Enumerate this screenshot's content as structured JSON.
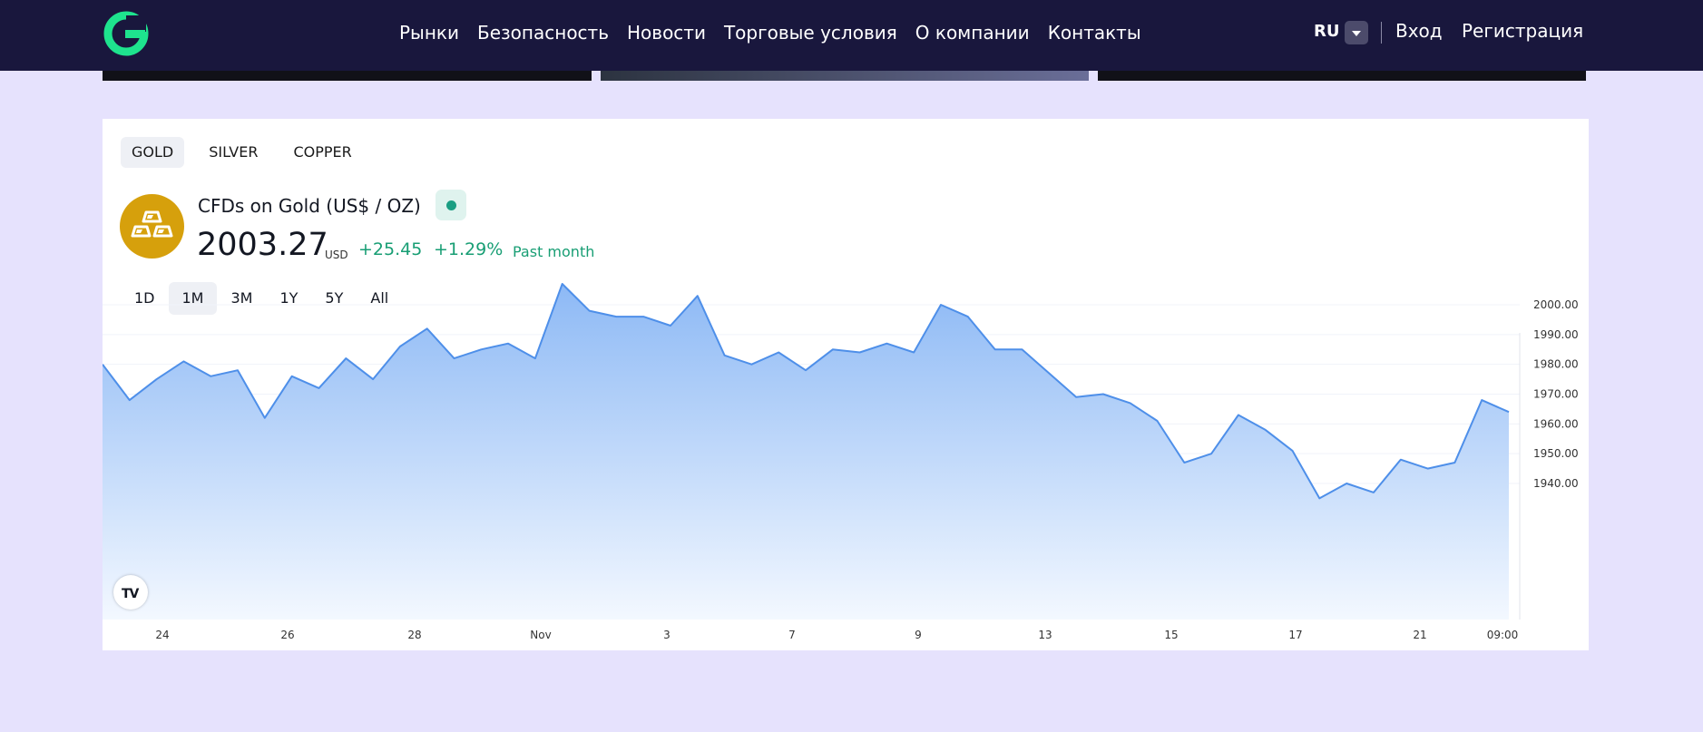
{
  "nav": {
    "links": [
      "Рынки",
      "Безопасность",
      "Новости",
      "Торговые условия",
      "О компании",
      "Контакты"
    ],
    "lang": "RU",
    "login": "Вход",
    "register": "Регистрация"
  },
  "widget": {
    "tabs": [
      "GOLD",
      "SILVER",
      "COPPER"
    ],
    "active_tab": "GOLD",
    "title": "CFDs on Gold (US$ / OZ)",
    "price": "2003.27",
    "price_unit": "USD",
    "change": "+25.45",
    "change_pct": "+1.29%",
    "period": "Past month",
    "ranges": [
      "1D",
      "1M",
      "3M",
      "1Y",
      "5Y",
      "All"
    ],
    "active_range": "1M",
    "tv_logo": "TV"
  },
  "colors": {
    "nav_bg": "#19173d",
    "page_bg": "#e6e2fd",
    "accent_green": "#189e74",
    "line": "#4e8fe9",
    "coin": "#d6a00c"
  },
  "chart_data": {
    "type": "area",
    "x_tick_labels": [
      "24",
      "26",
      "28",
      "Nov",
      "3",
      "7",
      "9",
      "13",
      "15",
      "17",
      "21",
      "09:00"
    ],
    "y_tick_labels": [
      "2000.00",
      "1990.00",
      "1980.00",
      "1970.00",
      "1960.00",
      "1950.00",
      "1940.00"
    ],
    "ylim": [
      1930,
      2010
    ],
    "x": [
      "Oct 23",
      "Oct 24",
      "Oct 24",
      "Oct 25",
      "Oct 25",
      "Oct 26",
      "Oct 26",
      "Oct 27",
      "Oct 27",
      "Oct 28",
      "Oct 28",
      "Oct 29",
      "Oct 29",
      "Oct 30",
      "Oct 31",
      "Nov 1",
      "Nov 1",
      "Nov 2",
      "Nov 2",
      "Nov 3",
      "Nov 3",
      "Nov 4",
      "Nov 4",
      "Nov 5",
      "Nov 6",
      "Nov 7",
      "Nov 7",
      "Nov 8",
      "Nov 8",
      "Nov 9",
      "Nov 9",
      "Nov 10",
      "Nov 10",
      "Nov 11",
      "Nov 12",
      "Nov 13",
      "Nov 13",
      "Nov 14",
      "Nov 14",
      "Nov 15",
      "Nov 15",
      "Nov 16",
      "Nov 16",
      "Nov 17",
      "Nov 17",
      "Nov 18",
      "Nov 19",
      "Nov 20",
      "Nov 20",
      "Nov 21",
      "Nov 21",
      "Nov 22",
      "Nov 22"
    ],
    "values": [
      1980,
      1968,
      1975,
      1981,
      1976,
      1978,
      1962,
      1976,
      1972,
      1982,
      1975,
      1986,
      1992,
      1982,
      1985,
      1987,
      1982,
      2007,
      1998,
      1996,
      1996,
      1993,
      2003,
      1983,
      1980,
      1984,
      1978,
      1985,
      1984,
      1987,
      1984,
      2000,
      1996,
      1985,
      1985,
      1977,
      1969,
      1970,
      1967,
      1961,
      1947,
      1950,
      1963,
      1958,
      1951,
      1935,
      1940,
      1937,
      1948,
      1945,
      1947,
      1968,
      1964
    ]
  }
}
